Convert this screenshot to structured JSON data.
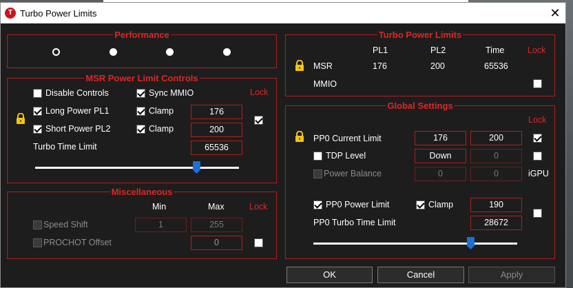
{
  "window": {
    "title": "Turbo Power Limits",
    "icon_letter": "T"
  },
  "performance": {
    "title": "Performance",
    "selected": 0
  },
  "msr": {
    "title": "MSR Power Limit Controls",
    "lock_label": "Lock",
    "disable_controls": "Disable Controls",
    "sync_mmio": "Sync MMIO",
    "long_pl1": "Long Power PL1",
    "short_pl2": "Short Power PL2",
    "clamp": "Clamp",
    "pl1_value": "176",
    "pl2_value": "200",
    "turbo_time_label": "Turbo Time Limit",
    "turbo_time_value": "65536",
    "slider_fraction": 0.79
  },
  "misc": {
    "title": "Miscellaneous",
    "min": "Min",
    "max": "Max",
    "lock_label": "Lock",
    "speed_shift": "Speed Shift",
    "speed_shift_min": "1",
    "speed_shift_max": "255",
    "prochot": "PROCHOT Offset",
    "prochot_value": "0"
  },
  "turbo": {
    "title": "Turbo Power Limits",
    "pl1": "PL1",
    "pl2": "PL2",
    "time": "Time",
    "lock_label": "Lock",
    "msr": "MSR",
    "msr_pl1": "176",
    "msr_pl2": "200",
    "msr_time": "65536",
    "mmio": "MMIO"
  },
  "global": {
    "title": "Global Settings",
    "lock_label": "Lock",
    "pp0_current": "PP0 Current Limit",
    "pp0_current_a": "176",
    "pp0_current_b": "200",
    "tdp_level": "TDP Level",
    "tdp_value": "Down",
    "tdp_b": "0",
    "power_balance": "Power Balance",
    "pb_a": "0",
    "pb_b": "0",
    "igpu": "iGPU",
    "pp0_power_limit": "PP0 Power Limit",
    "clamp": "Clamp",
    "pp0_power_value": "190",
    "pp0_turbo_time": "PP0 Turbo Time Limit",
    "pp0_turbo_value": "28672",
    "slider_fraction": 0.77
  },
  "buttons": {
    "ok": "OK",
    "cancel": "Cancel",
    "apply": "Apply"
  }
}
